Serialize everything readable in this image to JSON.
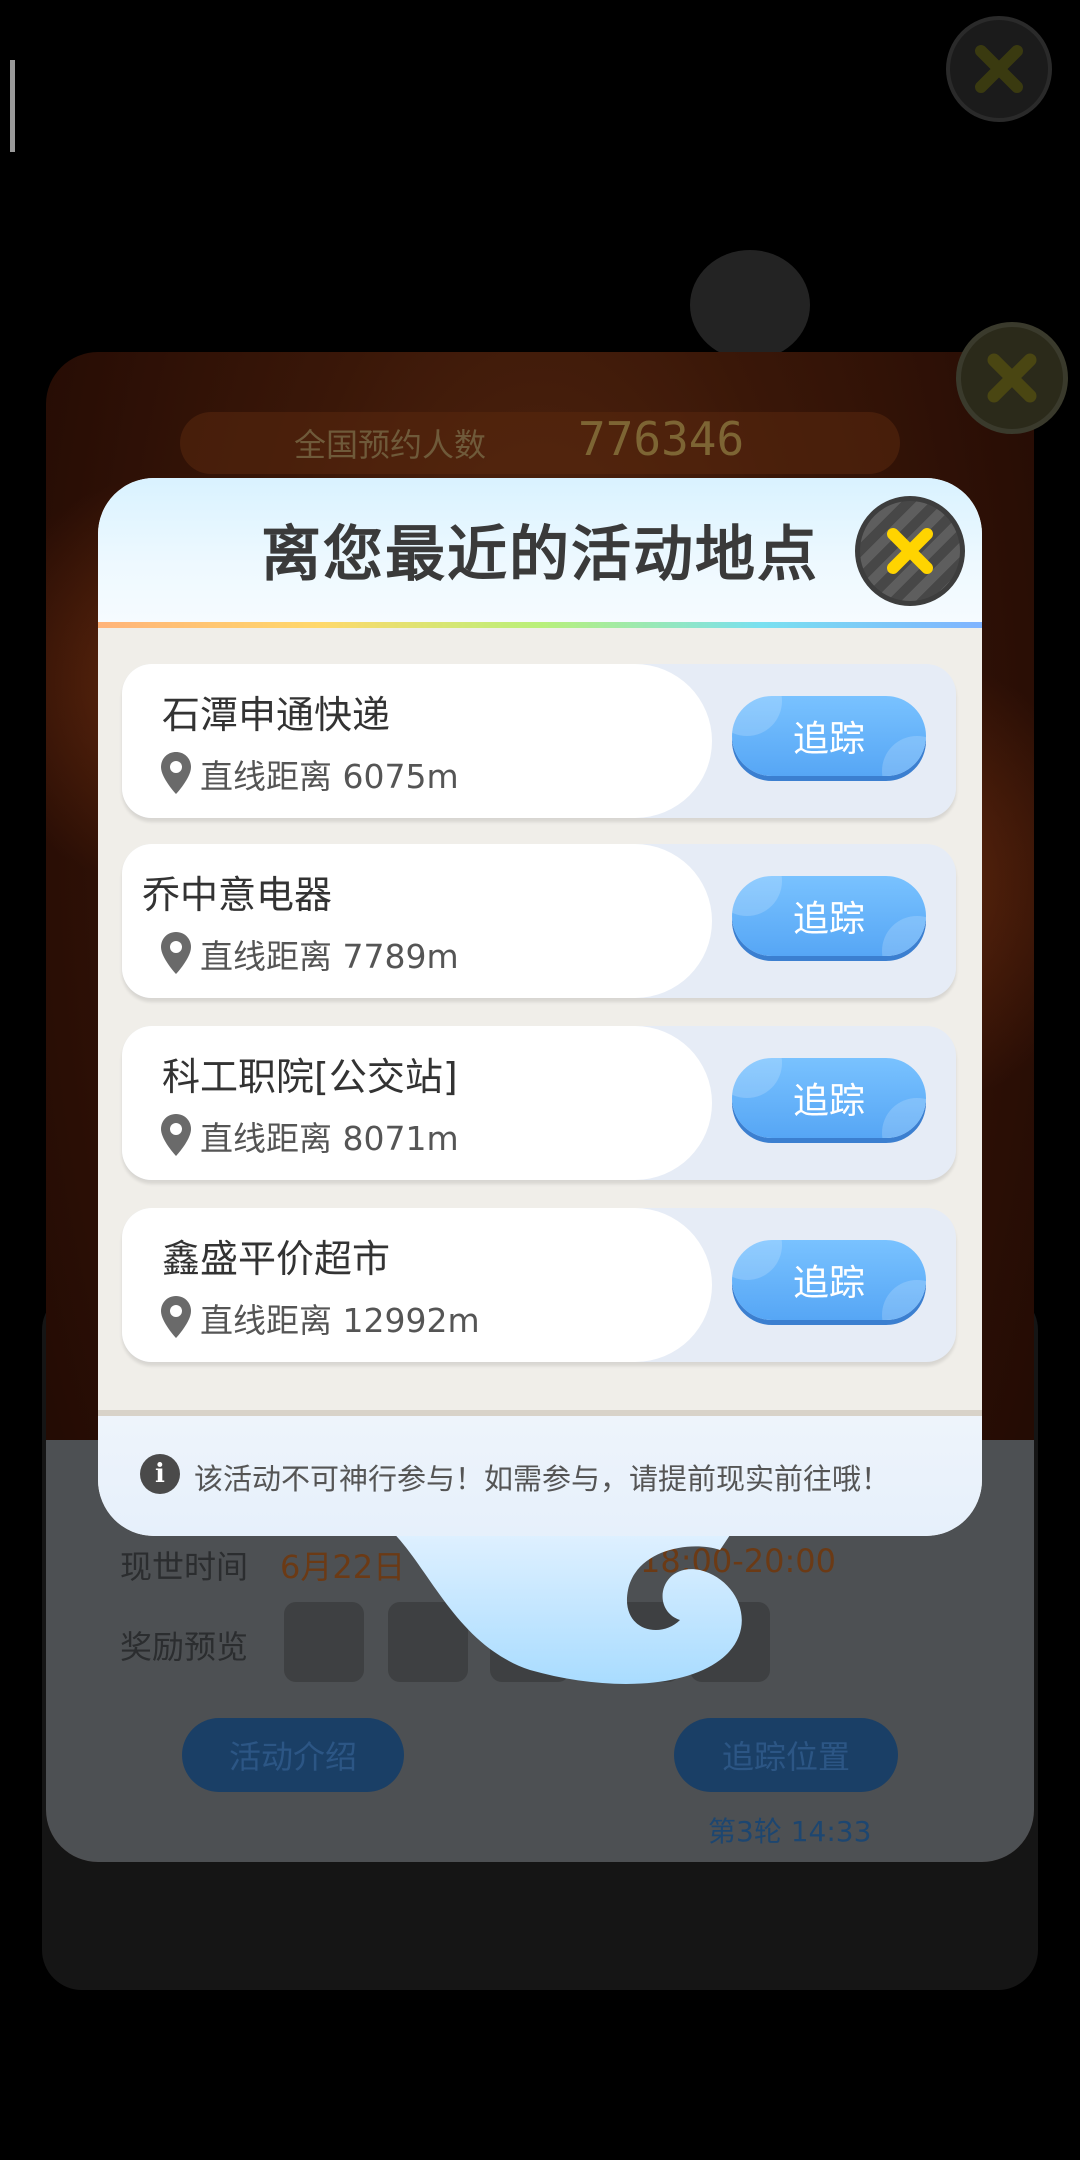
{
  "background": {
    "reservation_label": "全国预约人数",
    "reservation_count": "776346",
    "time_label": "现世时间",
    "time_value_left": "6月22日",
    "time_value_right": "18:00-20:00",
    "reward_label": "奖励预览",
    "intro_button": "活动介绍",
    "track_position_button": "追踪位置",
    "round_info": "第3轮 14:33"
  },
  "dialog": {
    "title": "离您最近的活动地点",
    "locations": [
      {
        "name": "石潭申通快递",
        "distance": "直线距离 6075m",
        "action": "追踪"
      },
      {
        "name": "乔中意电器",
        "distance": "直线距离 7789m",
        "action": "追踪"
      },
      {
        "name": "科工职院[公交站]",
        "distance": "直线距离 8071m",
        "action": "追踪"
      },
      {
        "name": "鑫盛平价超市",
        "distance": "直线距离 12992m",
        "action": "追踪"
      }
    ],
    "footer_note": "该活动不可神行参与！如需参与，请提前现实前往哦！"
  },
  "icons": {
    "close": "close-icon",
    "location": "location-pin-icon",
    "info": "info-icon"
  },
  "colors": {
    "accent_yellow": "#ffd400",
    "button_blue": "#56a6f5",
    "title_gray": "#3a3a3a"
  }
}
